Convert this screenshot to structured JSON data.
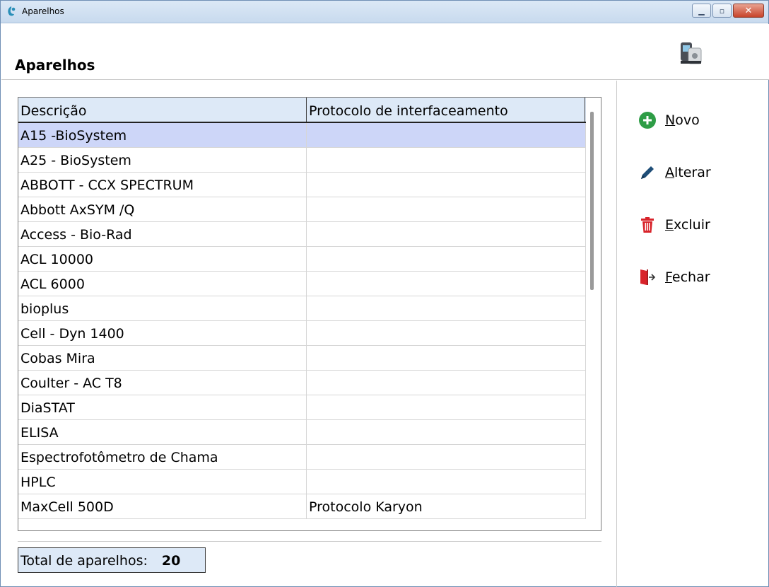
{
  "window": {
    "title": "Aparelhos",
    "controls": [
      "minimize",
      "maximize",
      "close"
    ]
  },
  "header": {
    "title": "Aparelhos",
    "icon": "analyzer-device-icon"
  },
  "grid": {
    "columns": [
      "Descrição",
      "Protocolo de interfaceamento"
    ],
    "selected_index": 0,
    "rows": [
      {
        "descricao": "A15 -BioSystem",
        "protocolo": ""
      },
      {
        "descricao": "A25 - BioSystem",
        "protocolo": ""
      },
      {
        "descricao": "ABBOTT - CCX SPECTRUM",
        "protocolo": ""
      },
      {
        "descricao": "Abbott AxSYM /Q",
        "protocolo": ""
      },
      {
        "descricao": "Access - Bio-Rad",
        "protocolo": ""
      },
      {
        "descricao": "ACL 10000",
        "protocolo": ""
      },
      {
        "descricao": "ACL 6000",
        "protocolo": ""
      },
      {
        "descricao": "bioplus",
        "protocolo": ""
      },
      {
        "descricao": "Cell - Dyn 1400",
        "protocolo": ""
      },
      {
        "descricao": "Cobas Mira",
        "protocolo": ""
      },
      {
        "descricao": "Coulter - AC T8",
        "protocolo": ""
      },
      {
        "descricao": "DiaSTAT",
        "protocolo": ""
      },
      {
        "descricao": "ELISA",
        "protocolo": ""
      },
      {
        "descricao": "Espectrofotômetro de Chama",
        "protocolo": ""
      },
      {
        "descricao": "HPLC",
        "protocolo": ""
      },
      {
        "descricao": "MaxCell 500D",
        "protocolo": "Protocolo Karyon"
      }
    ]
  },
  "footer": {
    "total_label": "Total de aparelhos:",
    "total_value": "20"
  },
  "actions": {
    "novo": {
      "accel": "N",
      "rest": "ovo",
      "icon": "plus-circle-icon",
      "color": "#2e9d46"
    },
    "alterar": {
      "accel": "A",
      "rest": "lterar",
      "icon": "pencil-icon",
      "color": "#1f4e78"
    },
    "excluir": {
      "accel": "E",
      "rest": "xcluir",
      "icon": "trash-icon",
      "color": "#d8232a"
    },
    "fechar": {
      "accel": "F",
      "rest": "echar",
      "icon": "exit-door-icon",
      "color": "#d8232a"
    }
  }
}
